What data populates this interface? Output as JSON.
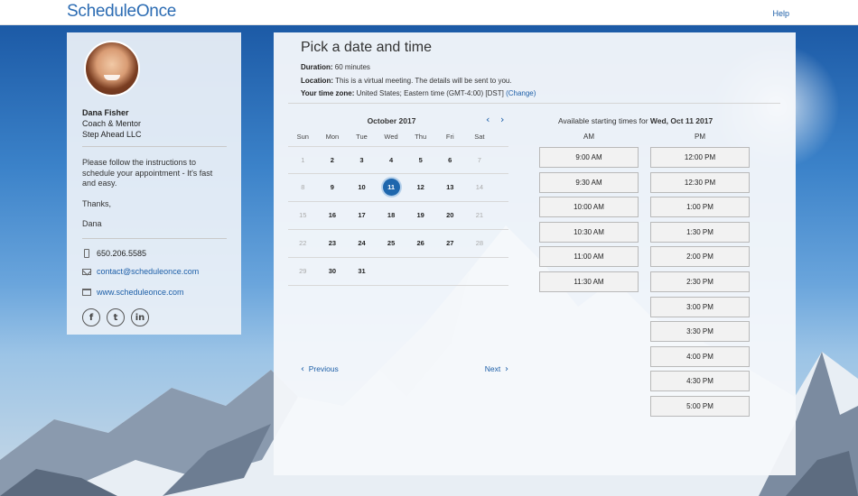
{
  "brand": {
    "logo": "ScheduleOnce",
    "help": "Help"
  },
  "profile": {
    "name": "Dana Fisher",
    "role": "Coach & Mentor",
    "company": "Step Ahead LLC",
    "note": [
      "Please follow the instructions to schedule your appointment - It's fast and easy.",
      "Thanks,",
      "Dana"
    ],
    "phone": "650.206.5585",
    "email": "contact@scheduleonce.com",
    "website": "www.scheduleonce.com",
    "social": [
      "f",
      "t",
      "in"
    ]
  },
  "booking": {
    "title": "Pick a date and time",
    "duration_label": "Duration:",
    "duration": "60 minutes",
    "location_label": "Location:",
    "location": "This is a virtual meeting. The details will be sent to you.",
    "tz_label": "Your time zone:",
    "tz_value": "United States;  Eastern time  (GMT-4:00) [DST]",
    "tz_change": "(Change)"
  },
  "calendar": {
    "month": "October 2017",
    "weekdays": [
      "Sun",
      "Mon",
      "Tue",
      "Wed",
      "Thu",
      "Fri",
      "Sat"
    ],
    "weeks": [
      [
        {
          "d": "1",
          "s": "off"
        },
        {
          "d": "2",
          "s": "avail"
        },
        {
          "d": "3",
          "s": "avail"
        },
        {
          "d": "4",
          "s": "avail"
        },
        {
          "d": "5",
          "s": "avail"
        },
        {
          "d": "6",
          "s": "avail"
        },
        {
          "d": "7",
          "s": "off"
        }
      ],
      [
        {
          "d": "8",
          "s": "off"
        },
        {
          "d": "9",
          "s": "avail"
        },
        {
          "d": "10",
          "s": "avail"
        },
        {
          "d": "11",
          "s": "sel"
        },
        {
          "d": "12",
          "s": "avail"
        },
        {
          "d": "13",
          "s": "avail"
        },
        {
          "d": "14",
          "s": "off"
        }
      ],
      [
        {
          "d": "15",
          "s": "off"
        },
        {
          "d": "16",
          "s": "avail"
        },
        {
          "d": "17",
          "s": "avail"
        },
        {
          "d": "18",
          "s": "avail"
        },
        {
          "d": "19",
          "s": "avail"
        },
        {
          "d": "20",
          "s": "avail"
        },
        {
          "d": "21",
          "s": "off"
        }
      ],
      [
        {
          "d": "22",
          "s": "off"
        },
        {
          "d": "23",
          "s": "avail"
        },
        {
          "d": "24",
          "s": "avail"
        },
        {
          "d": "25",
          "s": "avail"
        },
        {
          "d": "26",
          "s": "avail"
        },
        {
          "d": "27",
          "s": "avail"
        },
        {
          "d": "28",
          "s": "off"
        }
      ],
      [
        {
          "d": "29",
          "s": "off"
        },
        {
          "d": "30",
          "s": "avail"
        },
        {
          "d": "31",
          "s": "avail"
        },
        {
          "d": "",
          "s": "empty"
        },
        {
          "d": "",
          "s": "empty"
        },
        {
          "d": "",
          "s": "empty"
        },
        {
          "d": "",
          "s": "empty"
        }
      ]
    ],
    "previous": "Previous",
    "next": "Next"
  },
  "times": {
    "header_prefix": "Available starting times for ",
    "header_date": "Wed, Oct 11 2017",
    "am_label": "AM",
    "pm_label": "PM",
    "am": [
      "9:00 AM",
      "9:30 AM",
      "10:00 AM",
      "10:30 AM",
      "11:00 AM",
      "11:30 AM"
    ],
    "pm": [
      "12:00 PM",
      "12:30 PM",
      "1:00 PM",
      "1:30 PM",
      "2:00 PM",
      "2:30 PM",
      "3:00 PM",
      "3:30 PM",
      "4:00 PM",
      "4:30 PM",
      "5:00 PM"
    ]
  }
}
